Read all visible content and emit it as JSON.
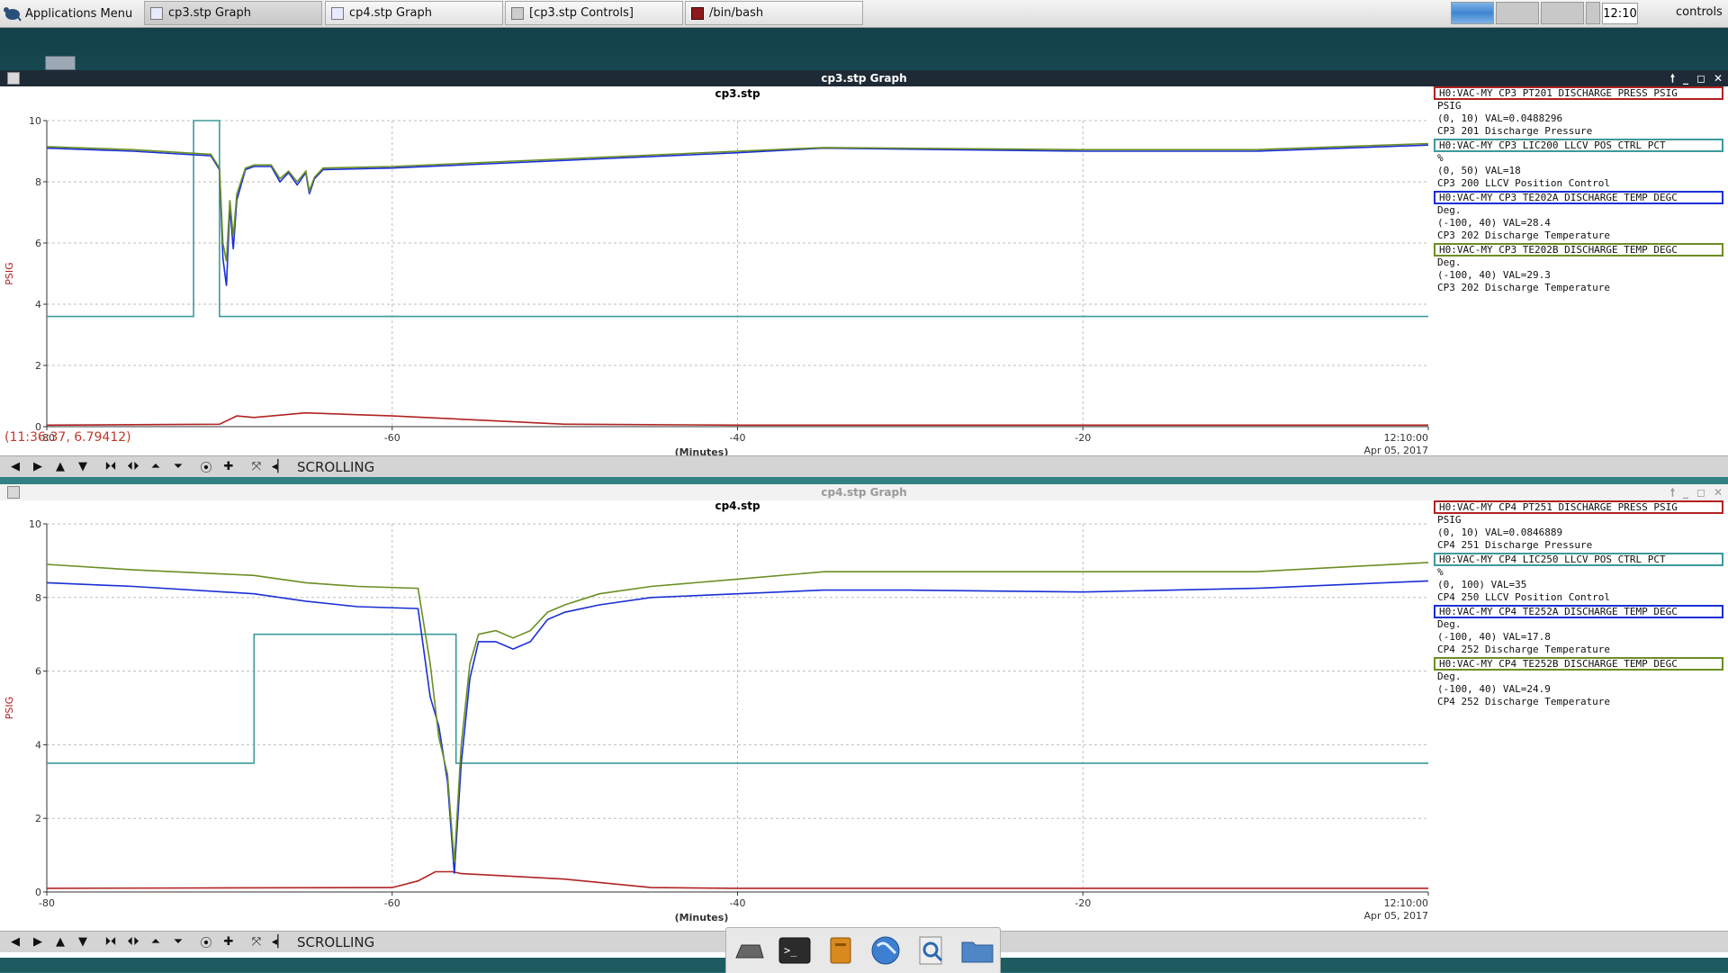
{
  "panel": {
    "app_menu": "Applications Menu",
    "tasks": [
      {
        "label": "cp3.stp Graph"
      },
      {
        "label": "cp4.stp Graph"
      },
      {
        "label": "[cp3.stp Controls]"
      },
      {
        "label": "/bin/bash"
      }
    ],
    "clock": "12:10",
    "user": "controls"
  },
  "windows": [
    {
      "title": "cp3.stp Graph",
      "plot_title": "cp3.stp",
      "y_label": "PSIG",
      "x_label": "(Minutes)",
      "date_label": "Apr 05, 2017",
      "cursor_readout": "(11:36:37, 6.79412)",
      "scrolling_label": "SCROLLING",
      "legend": [
        {
          "tag": "H0:VAC-MY_CP3_PT201_DISCHARGE_PRESS_PSIG",
          "unit": "PSIG",
          "range": "(0, 10) VAL=0.0488296",
          "desc": "CP3 201 Discharge Pressure",
          "color": "#b22222"
        },
        {
          "tag": "H0:VAC-MY_CP3_LIC200_LLCV_POS_CTRL_PCT",
          "unit": "%",
          "range": "(0, 50) VAL=18",
          "desc": "CP3 200 LLCV Position Control",
          "color": "#3d9a9a"
        },
        {
          "tag": "H0:VAC-MY_CP3_TE202A_DISCHARGE_TEMP_DEGC",
          "unit": "Deg.",
          "range": "(-100, 40) VAL=28.4",
          "desc": "CP3 202 Discharge Temperature",
          "color": "#1a2fd6"
        },
        {
          "tag": "H0:VAC-MY_CP3_TE202B_DISCHARGE_TEMP_DEGC",
          "unit": "Deg.",
          "range": "(-100, 40) VAL=29.3",
          "desc": "CP3 202 Discharge Temperature",
          "color": "#6b8e23"
        }
      ],
      "chart_data": {
        "type": "line",
        "title": "cp3.stp",
        "xlabel": "(Minutes)",
        "ylabel": "PSIG",
        "xlim": [
          -80,
          0
        ],
        "ylim": [
          0,
          10
        ],
        "x_ticks": [
          "-80",
          "-60",
          "-40",
          "-20",
          "12:10:00"
        ],
        "y_ticks": [
          "0",
          "2",
          "4",
          "6",
          "8",
          "10"
        ],
        "grid": true,
        "series": [
          {
            "name": "H0:VAC-MY_CP3_PT201_DISCHARGE_PRESS_PSIG",
            "color": "#b22222",
            "x": [
              -80,
              -70,
              -69,
              -68,
              -65,
              -60,
              -50,
              -40,
              -20,
              0
            ],
            "y": [
              0.05,
              0.08,
              0.35,
              0.3,
              0.45,
              0.35,
              0.08,
              0.05,
              0.05,
              0.05
            ]
          },
          {
            "name": "H0:VAC-MY_CP3_LIC200_LLCV_POS_CTRL_PCT",
            "color": "#3d9a9a",
            "step": true,
            "x": [
              -80,
              -71.5,
              -71.5,
              -70,
              -70,
              0
            ],
            "y": [
              3.6,
              3.6,
              10,
              10,
              3.6,
              3.6
            ]
          },
          {
            "name": "H0:VAC-MY_CP3_TE202A_DISCHARGE_TEMP_DEGC",
            "color": "#1a2fd6",
            "x": [
              -80,
              -75,
              -70.5,
              -70,
              -69.8,
              -69.6,
              -69.4,
              -69.2,
              -69,
              -68.5,
              -68,
              -67,
              -66.5,
              -66,
              -65.5,
              -65,
              -64.8,
              -64.5,
              -64,
              -60,
              -50,
              -40,
              -35,
              -20,
              -10,
              0
            ],
            "y": [
              9.1,
              9.0,
              8.85,
              8.4,
              5.5,
              4.6,
              7.2,
              5.8,
              7.4,
              8.4,
              8.5,
              8.5,
              8.0,
              8.3,
              7.9,
              8.3,
              7.6,
              8.1,
              8.4,
              8.45,
              8.7,
              8.95,
              9.1,
              9.0,
              9.0,
              9.2
            ]
          },
          {
            "name": "H0:VAC-MY_CP3_TE202B_DISCHARGE_TEMP_DEGC",
            "color": "#6b8e23",
            "x": [
              -80,
              -75,
              -70.5,
              -70,
              -69.8,
              -69.6,
              -69.4,
              -69.2,
              -69,
              -68.5,
              -68,
              -67,
              -66.5,
              -66,
              -65.5,
              -65,
              -64.8,
              -64.5,
              -64,
              -60,
              -50,
              -40,
              -35,
              -20,
              -10,
              0
            ],
            "y": [
              9.15,
              9.05,
              8.9,
              8.45,
              6.0,
              5.4,
              7.4,
              6.2,
              7.6,
              8.45,
              8.55,
              8.55,
              8.1,
              8.35,
              8.0,
              8.35,
              7.7,
              8.15,
              8.45,
              8.5,
              8.75,
              9.0,
              9.12,
              9.05,
              9.05,
              9.25
            ]
          }
        ]
      }
    },
    {
      "title": "cp4.stp Graph",
      "plot_title": "cp4.stp",
      "y_label": "PSIG",
      "x_label": "(Minutes)",
      "date_label": "Apr 05, 2017",
      "cursor_readout": "",
      "scrolling_label": "SCROLLING",
      "legend": [
        {
          "tag": "H0:VAC-MY_CP4_PT251_DISCHARGE_PRESS_PSIG",
          "unit": "PSIG",
          "range": "(0, 10) VAL=0.0846889",
          "desc": "CP4 251 Discharge Pressure",
          "color": "#b22222"
        },
        {
          "tag": "H0:VAC-MY_CP4_LIC250_LLCV_POS_CTRL_PCT",
          "unit": "%",
          "range": "(0, 100) VAL=35",
          "desc": "CP4 250 LLCV Position Control",
          "color": "#3d9a9a"
        },
        {
          "tag": "H0:VAC-MY_CP4_TE252A_DISCHARGE_TEMP_DEGC",
          "unit": "Deg.",
          "range": "(-100, 40) VAL=17.8",
          "desc": "CP4 252 Discharge Temperature",
          "color": "#1a2fd6"
        },
        {
          "tag": "H0:VAC-MY_CP4_TE252B_DISCHARGE_TEMP_DEGC",
          "unit": "Deg.",
          "range": "(-100, 40) VAL=24.9",
          "desc": "CP4 252 Discharge Temperature",
          "color": "#6b8e23"
        }
      ],
      "chart_data": {
        "type": "line",
        "title": "cp4.stp",
        "xlabel": "(Minutes)",
        "ylabel": "PSIG",
        "xlim": [
          -80,
          0
        ],
        "ylim": [
          0,
          10
        ],
        "x_ticks": [
          "-80",
          "-60",
          "-40",
          "-20",
          "12:10:00"
        ],
        "y_ticks": [
          "0",
          "2",
          "4",
          "6",
          "8",
          "10"
        ],
        "grid": true,
        "series": [
          {
            "name": "H0:VAC-MY_CP4_PT251_DISCHARGE_PRESS_PSIG",
            "color": "#b22222",
            "x": [
              -80,
              -60,
              -58.5,
              -57.5,
              -56.5,
              -56,
              -54,
              -50,
              -45,
              -40,
              -20,
              0
            ],
            "y": [
              0.1,
              0.12,
              0.3,
              0.55,
              0.55,
              0.5,
              0.45,
              0.35,
              0.12,
              0.1,
              0.1,
              0.1
            ]
          },
          {
            "name": "H0:VAC-MY_CP4_LIC250_LLCV_POS_CTRL_PCT",
            "color": "#3d9a9a",
            "step": true,
            "x": [
              -80,
              -68,
              -68,
              -56.3,
              -56.3,
              0
            ],
            "y": [
              3.5,
              3.5,
              7.0,
              7.0,
              3.5,
              3.5
            ]
          },
          {
            "name": "H0:VAC-MY_CP4_TE252A_DISCHARGE_TEMP_DEGC",
            "color": "#1a2fd6",
            "x": [
              -80,
              -75,
              -68,
              -65,
              -62,
              -58.5,
              -57.8,
              -57.3,
              -56.8,
              -56.4,
              -56,
              -55.5,
              -55,
              -54,
              -53,
              -52,
              -51,
              -50,
              -48,
              -45,
              -40,
              -35,
              -30,
              -20,
              -10,
              0
            ],
            "y": [
              8.4,
              8.3,
              8.1,
              7.9,
              7.75,
              7.7,
              5.3,
              4.5,
              3.0,
              0.5,
              3.5,
              5.8,
              6.8,
              6.8,
              6.6,
              6.8,
              7.4,
              7.6,
              7.8,
              8.0,
              8.1,
              8.2,
              8.2,
              8.15,
              8.25,
              8.45
            ]
          },
          {
            "name": "H0:VAC-MY_CP4_TE252B_DISCHARGE_TEMP_DEGC",
            "color": "#6b8e23",
            "x": [
              -80,
              -75,
              -68,
              -65,
              -62,
              -58.5,
              -57.8,
              -57.3,
              -56.8,
              -56.4,
              -56,
              -55.5,
              -55,
              -54,
              -53,
              -52,
              -51,
              -50,
              -48,
              -45,
              -40,
              -35,
              -30,
              -20,
              -10,
              0
            ],
            "y": [
              8.9,
              8.75,
              8.6,
              8.4,
              8.3,
              8.25,
              6.2,
              4.2,
              3.2,
              0.8,
              4.0,
              6.2,
              7.0,
              7.1,
              6.9,
              7.1,
              7.6,
              7.8,
              8.1,
              8.3,
              8.5,
              8.7,
              8.7,
              8.7,
              8.7,
              8.95
            ]
          }
        ]
      }
    }
  ],
  "toolbar_icons": [
    "arrow-left-icon",
    "arrow-right-icon",
    "arrow-up-icon",
    "arrow-down-icon",
    "zoom-x-in-icon",
    "zoom-x-out-icon",
    "zoom-y-in-icon",
    "zoom-y-out-icon",
    "record-icon",
    "crosshair-icon",
    "autoscale-icon",
    "back-icon"
  ],
  "dock": [
    "show-desktop-icon",
    "terminal-icon",
    "file-manager-icon",
    "web-browser-icon",
    "search-icon",
    "folder-icon"
  ]
}
